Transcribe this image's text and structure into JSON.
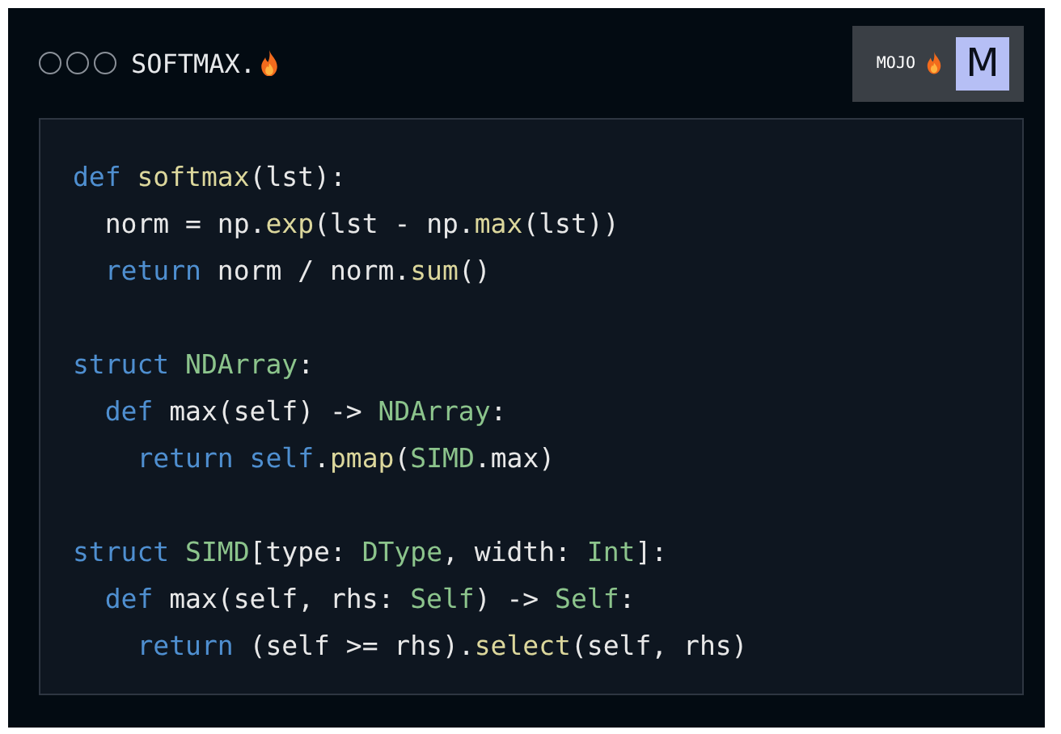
{
  "header": {
    "title": "SOFTMAX.",
    "badge": {
      "label": "MOJO",
      "logo_letter": "M"
    }
  },
  "code_blocks": [
    [
      [
        {
          "kind": "kw",
          "text": "def "
        },
        {
          "kind": "fn",
          "text": "softmax"
        },
        {
          "kind": "plain",
          "text": "(lst):"
        }
      ],
      [
        {
          "kind": "plain",
          "text": "  norm = np."
        },
        {
          "kind": "fn",
          "text": "exp"
        },
        {
          "kind": "plain",
          "text": "(lst - np."
        },
        {
          "kind": "fn",
          "text": "max"
        },
        {
          "kind": "plain",
          "text": "(lst))"
        }
      ],
      [
        {
          "kind": "kw",
          "text": "  return "
        },
        {
          "kind": "plain",
          "text": "norm / norm."
        },
        {
          "kind": "fn",
          "text": "sum"
        },
        {
          "kind": "plain",
          "text": "()"
        }
      ]
    ],
    [
      [
        {
          "kind": "kw",
          "text": "struct "
        },
        {
          "kind": "type",
          "text": "NDArray"
        },
        {
          "kind": "plain",
          "text": ":"
        }
      ],
      [
        {
          "kind": "kw",
          "text": "  def "
        },
        {
          "kind": "plain",
          "text": "max(self) -> "
        },
        {
          "kind": "type",
          "text": "NDArray"
        },
        {
          "kind": "plain",
          "text": ":"
        }
      ],
      [
        {
          "kind": "kw",
          "text": "    return self"
        },
        {
          "kind": "plain",
          "text": "."
        },
        {
          "kind": "fn",
          "text": "pmap"
        },
        {
          "kind": "plain",
          "text": "("
        },
        {
          "kind": "type",
          "text": "SIMD"
        },
        {
          "kind": "plain",
          "text": ".max)"
        }
      ]
    ],
    [
      [
        {
          "kind": "kw",
          "text": "struct "
        },
        {
          "kind": "type",
          "text": "SIMD"
        },
        {
          "kind": "plain",
          "text": "[type: "
        },
        {
          "kind": "type",
          "text": "DType"
        },
        {
          "kind": "plain",
          "text": ", width: "
        },
        {
          "kind": "type",
          "text": "Int"
        },
        {
          "kind": "plain",
          "text": "]:"
        }
      ],
      [
        {
          "kind": "kw",
          "text": "  def "
        },
        {
          "kind": "plain",
          "text": "max(self, rhs: "
        },
        {
          "kind": "type",
          "text": "Self"
        },
        {
          "kind": "plain",
          "text": ") -> "
        },
        {
          "kind": "type",
          "text": "Self"
        },
        {
          "kind": "plain",
          "text": ":"
        }
      ],
      [
        {
          "kind": "kw",
          "text": "    return "
        },
        {
          "kind": "plain",
          "text": "(self >= rhs)."
        },
        {
          "kind": "fn",
          "text": "select"
        },
        {
          "kind": "plain",
          "text": "(self, rhs)"
        }
      ]
    ]
  ]
}
